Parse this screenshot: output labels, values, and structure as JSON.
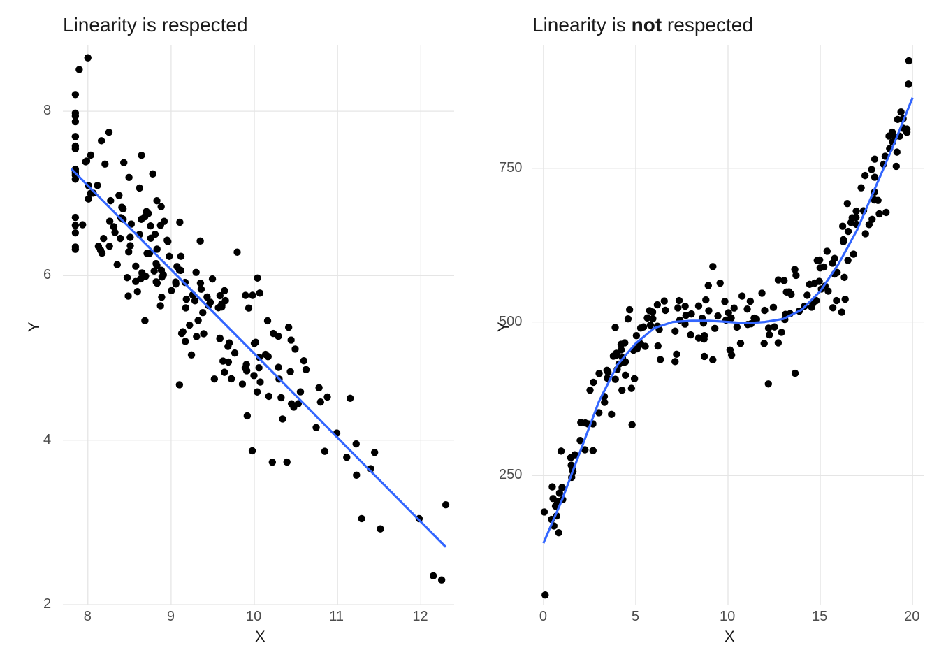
{
  "chart_data": [
    {
      "type": "scatter",
      "title": "Linearity is respected",
      "xlabel": "X",
      "ylabel": "Y",
      "xlim": [
        7.7,
        12.4
      ],
      "ylim": [
        2,
        8.8
      ],
      "x_ticks": [
        8,
        9,
        10,
        11,
        12
      ],
      "y_ticks": [
        2,
        4,
        6,
        8
      ],
      "fit_line": {
        "x1": 7.8,
        "y1": 7.3,
        "x2": 12.3,
        "y2": 2.7
      },
      "line_color": "#3366FF",
      "point_color": "#000000"
    },
    {
      "type": "scatter",
      "title_parts": [
        "Linearity is ",
        "not",
        " respected"
      ],
      "xlabel": "X",
      "ylabel": "Y",
      "xlim": [
        -0.6,
        20.6
      ],
      "ylim": [
        40,
        950
      ],
      "x_ticks": [
        0,
        5,
        10,
        15,
        20
      ],
      "y_ticks": [
        250,
        500,
        750
      ],
      "fit_curve": [
        {
          "x": 0,
          "y": 140
        },
        {
          "x": 1,
          "y": 210
        },
        {
          "x": 2,
          "y": 290
        },
        {
          "x": 3,
          "y": 370
        },
        {
          "x": 4,
          "y": 430
        },
        {
          "x": 5,
          "y": 465
        },
        {
          "x": 6,
          "y": 490
        },
        {
          "x": 7,
          "y": 500
        },
        {
          "x": 8,
          "y": 502
        },
        {
          "x": 9,
          "y": 502
        },
        {
          "x": 10,
          "y": 500
        },
        {
          "x": 11,
          "y": 498
        },
        {
          "x": 12,
          "y": 500
        },
        {
          "x": 13,
          "y": 505
        },
        {
          "x": 14,
          "y": 520
        },
        {
          "x": 15,
          "y": 550
        },
        {
          "x": 16,
          "y": 595
        },
        {
          "x": 17,
          "y": 650
        },
        {
          "x": 18,
          "y": 720
        },
        {
          "x": 19,
          "y": 790
        },
        {
          "x": 20,
          "y": 865
        }
      ],
      "line_color": "#3366FF",
      "point_color": "#000000"
    }
  ],
  "axis": {
    "left": {
      "x_label": "X",
      "y_label": "Y"
    },
    "right": {
      "x_label": "X",
      "y_label": "Y"
    }
  },
  "titles": {
    "left": "Linearity is respected",
    "right_pre": "Linearity is ",
    "right_bold": "not",
    "right_post": " respected"
  }
}
